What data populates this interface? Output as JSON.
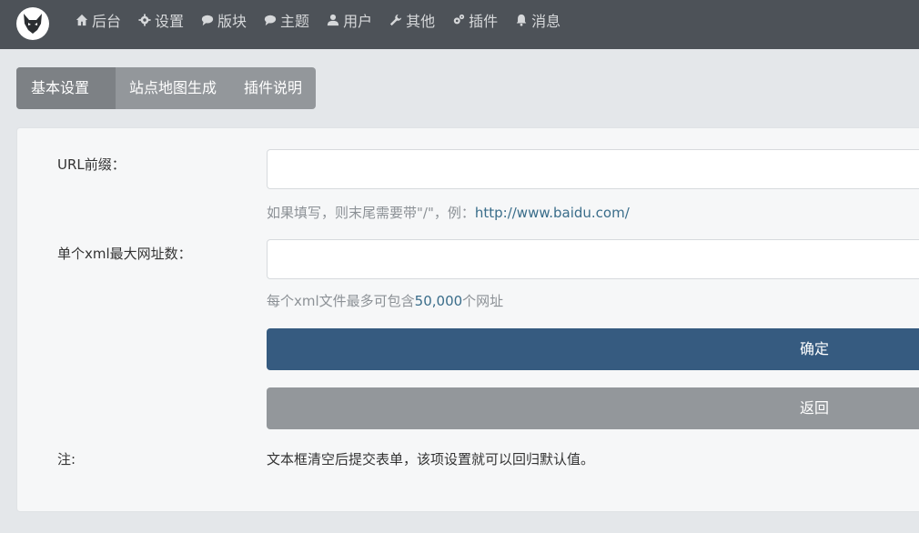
{
  "nav": {
    "items": [
      {
        "label": "后台",
        "icon": "home-icon"
      },
      {
        "label": "设置",
        "icon": "gear-icon"
      },
      {
        "label": "版块",
        "icon": "comment-icon"
      },
      {
        "label": "主题",
        "icon": "comment-icon"
      },
      {
        "label": "用户",
        "icon": "user-icon"
      },
      {
        "label": "其他",
        "icon": "wrench-icon"
      },
      {
        "label": "插件",
        "icon": "cogs-icon"
      },
      {
        "label": "消息",
        "icon": "bell-icon"
      }
    ]
  },
  "tabs": [
    {
      "label": "基本设置",
      "active": true
    },
    {
      "label": "站点地图生成",
      "active": false
    },
    {
      "label": "插件说明",
      "active": false
    }
  ],
  "form": {
    "url_prefix": {
      "label": "URL前缀：",
      "value": "",
      "help_prefix": "如果填写，则末尾需要带\"/\"，例：",
      "help_example": "http://www.baidu.com/"
    },
    "max_urls": {
      "label": "单个xml最大网址数：",
      "value": "",
      "help_prefix": "每个xml文件最多可包含",
      "help_number": "50,000",
      "help_suffix": "个网址"
    },
    "confirm_label": "确定",
    "back_label": "返回",
    "note_label": "注:",
    "note_text": "文本框清空后提交表单，该项设置就可以回归默认值。"
  },
  "colors": {
    "navbar": "#4d5258",
    "primary_button": "#365b80",
    "secondary_button": "#93979b",
    "link": "#3a6d8a"
  }
}
